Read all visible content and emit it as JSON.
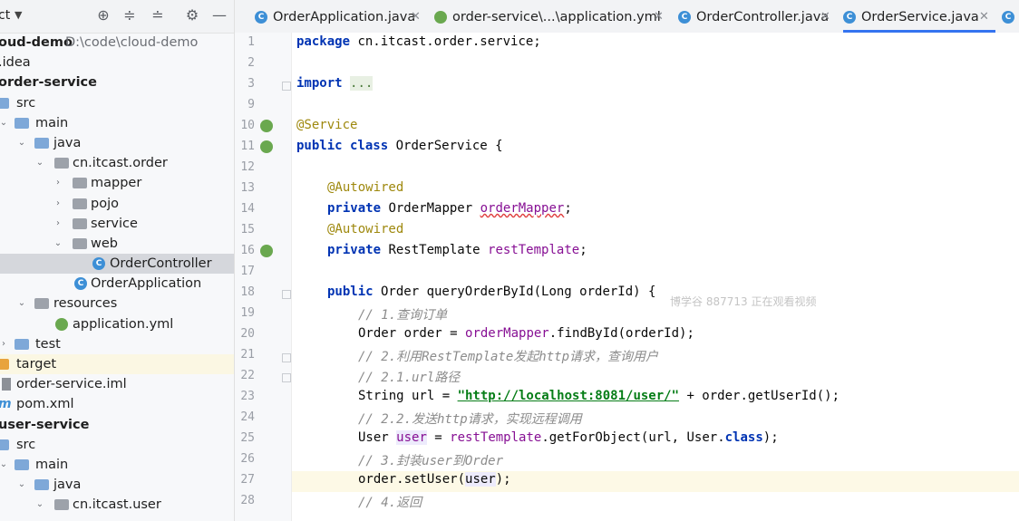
{
  "project_toolbar": {
    "title": "ct"
  },
  "tree": [
    {
      "label": "oud-demo",
      "path": "D:\\code\\cloud-demo",
      "depth": 0,
      "bold": true
    },
    {
      "label": ".idea",
      "depth": 0
    },
    {
      "label": "order-service",
      "depth": 0,
      "bold": true
    },
    {
      "label": "src",
      "depth": 0
    },
    {
      "label": "main",
      "depth": 1
    },
    {
      "label": "java",
      "depth": 2
    },
    {
      "label": "cn.itcast.order",
      "depth": 3
    },
    {
      "label": "mapper",
      "depth": 4
    },
    {
      "label": "pojo",
      "depth": 4
    },
    {
      "label": "service",
      "depth": 4
    },
    {
      "label": "web",
      "depth": 4
    },
    {
      "label": "OrderController",
      "depth": 5
    },
    {
      "label": "OrderApplication",
      "depth": 4
    },
    {
      "label": "resources",
      "depth": 2
    },
    {
      "label": "application.yml",
      "depth": 3
    },
    {
      "label": "test",
      "depth": 1
    },
    {
      "label": "target",
      "depth": 0
    },
    {
      "label": "order-service.iml",
      "depth": 0
    },
    {
      "label": "pom.xml",
      "depth": 0
    },
    {
      "label": "user-service",
      "depth": 0,
      "bold": true
    },
    {
      "label": "src",
      "depth": 0
    },
    {
      "label": "main",
      "depth": 1
    },
    {
      "label": "java",
      "depth": 2
    },
    {
      "label": "cn.itcast.user",
      "depth": 3
    }
  ],
  "tabs": [
    {
      "label": "OrderApplication.java"
    },
    {
      "label": "order-service\\...\\application.yml"
    },
    {
      "label": "OrderController.java"
    },
    {
      "label": "OrderService.java",
      "active": true
    }
  ],
  "code": {
    "line_numbers": [
      "1",
      "2",
      "3",
      "9",
      "10",
      "11",
      "12",
      "13",
      "14",
      "15",
      "16",
      "17",
      "18",
      "19",
      "20",
      "21",
      "22",
      "23",
      "24",
      "25",
      "26",
      "27",
      "28"
    ],
    "pkg_kw": "package",
    "pkg_name": " cn.itcast.order.service;",
    "import_kw": "import",
    "import_dots": "...",
    "ann_service": "@Service",
    "class_kw": "public class",
    "class_name": " OrderService {",
    "ann_autowired": "@Autowired",
    "private_kw": "private",
    "mapper_type": " OrderMapper ",
    "mapper_field": "orderMapper",
    "semicolon": ";",
    "resttemplate_type": " RestTemplate ",
    "resttemplate_field": "restTemplate",
    "method_kw": "public",
    "method_sig": " Order queryOrderById(Long orderId) {",
    "c1": "// 1.查询订单",
    "l20a": "Order order = ",
    "l20b": "orderMapper",
    "l20c": ".findById(orderId);",
    "c2": "// 2.利用RestTemplate发起http请求，查询用户",
    "c21": "// 2.1.url路径",
    "l23a": "String url = ",
    "l23b": "\"http://localhost:8081/user/\"",
    "l23c": " + order.getUserId();",
    "c22": "// 2.2.发送http请求，实现远程调用",
    "l25a": "User ",
    "l25b": "user",
    "l25c": " = ",
    "l25d": "restTemplate",
    "l25e": ".getForObject(url, User.",
    "l25f": "class",
    "l25g": ");",
    "c3": "// 3.封装user到Order",
    "l27a": "order.setUser(",
    "l27b": "user",
    "l27c": ");",
    "c4": "// 4.返回"
  },
  "watermark": "博学谷 887713 正在观看视频"
}
